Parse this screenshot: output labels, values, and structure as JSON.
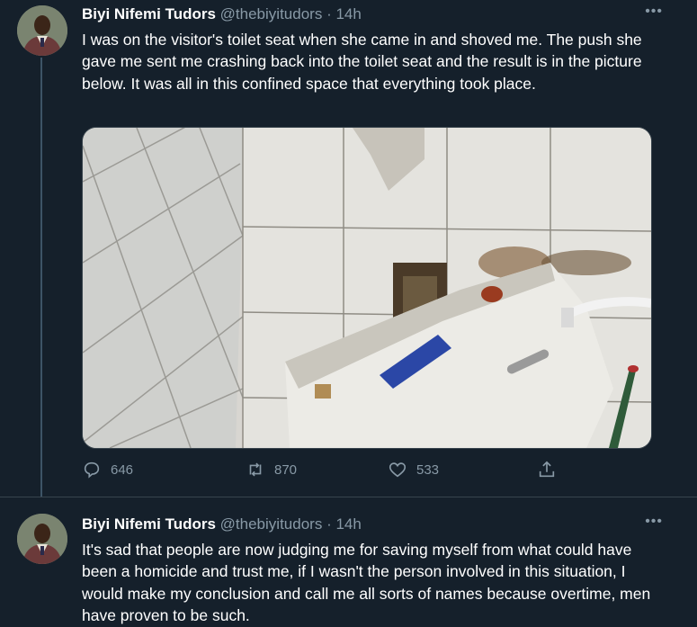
{
  "tweets": [
    {
      "display_name": "Biyi Nifemi Tudors",
      "handle": "@thebiyitudors",
      "separator": "·",
      "time": "14h",
      "more": "•••",
      "text": "I was on the visitor's toilet seat when she came in and shoved me. The push she gave me sent me crashing back into the toilet seat and the result is in the picture below. It was all in this confined space that everything took place.",
      "stats": {
        "replies": "646",
        "retweets": "870",
        "likes": "533"
      },
      "icons": [
        "reply-icon",
        "retweet-icon",
        "like-icon",
        "share-icon"
      ]
    },
    {
      "display_name": "Biyi Nifemi Tudors",
      "handle": "@thebiyitudors",
      "separator": "·",
      "time": "14h",
      "more": "•••",
      "text": "It's sad that people are now judging me for saving myself from what could have been a homicide and trust me, if I wasn't the person involved in this situation, I would make my conclusion and call me all sorts of names because overtime, men have proven to be such."
    }
  ],
  "colors": {
    "background": "#15202b",
    "text": "#ffffff",
    "muted": "#8899a6",
    "border": "#38444d"
  }
}
